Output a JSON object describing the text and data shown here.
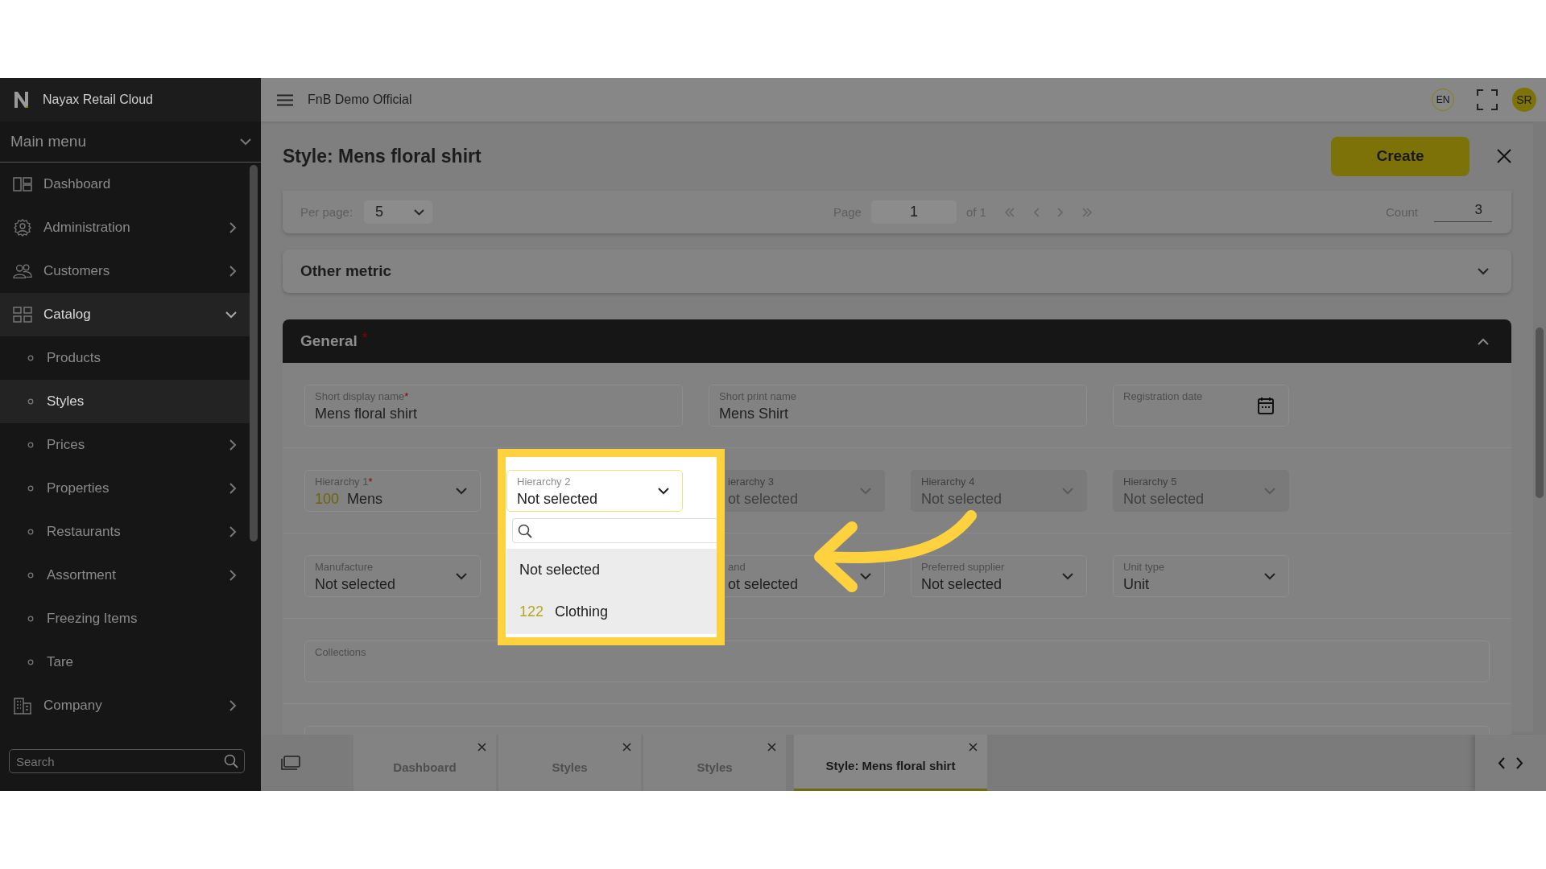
{
  "app": {
    "name": "Nayax Retail Cloud"
  },
  "sidebar": {
    "menu_title": "Main menu",
    "items": [
      {
        "label": "Dashboard",
        "has_submenu": false,
        "selected": false
      },
      {
        "label": "Administration",
        "has_submenu": true,
        "selected": false
      },
      {
        "label": "Customers",
        "has_submenu": true,
        "selected": false
      },
      {
        "label": "Catalog",
        "has_submenu": true,
        "selected": true,
        "expanded": true,
        "children": [
          {
            "label": "Products",
            "has_submenu": false,
            "selected": false
          },
          {
            "label": "Styles",
            "has_submenu": false,
            "selected": true
          },
          {
            "label": "Prices",
            "has_submenu": true,
            "selected": false
          },
          {
            "label": "Properties",
            "has_submenu": true,
            "selected": false
          },
          {
            "label": "Restaurants",
            "has_submenu": true,
            "selected": false
          },
          {
            "label": "Assortment",
            "has_submenu": true,
            "selected": false
          },
          {
            "label": "Freezing Items",
            "has_submenu": false,
            "selected": false
          },
          {
            "label": "Tare",
            "has_submenu": false,
            "selected": false
          }
        ]
      },
      {
        "label": "Company",
        "has_submenu": true,
        "selected": false
      }
    ],
    "search": {
      "placeholder": "Search"
    }
  },
  "topbar": {
    "org": "FnB Demo Official",
    "language": "EN",
    "avatar": "SR"
  },
  "page": {
    "title": "Style: Mens floral shirt",
    "create_button": "Create"
  },
  "pagination": {
    "per_page_label": "Per page:",
    "per_page": "5",
    "page_label": "Page",
    "page": "1",
    "of": "of 1",
    "count_label": "Count",
    "count": "3"
  },
  "other_metric": {
    "title": "Other metric",
    "expanded": false
  },
  "general": {
    "title": "General",
    "mark": "*",
    "expanded": true,
    "name_fields": [
      {
        "kind": "text",
        "label": "Short display name",
        "mark": "*",
        "value": "Mens floral shirt"
      },
      {
        "kind": "text",
        "label": "Short print name",
        "value": "Mens Shirt"
      },
      {
        "kind": "date",
        "label": "Registration date"
      }
    ],
    "rows": [
      [
        {
          "kind": "select",
          "label": "Hierarchy 1",
          "mark": "*",
          "code": "100",
          "value": "Mens"
        },
        {
          "kind": "select",
          "label": "Hierarchy 2",
          "value": "Not selected",
          "open": true,
          "options": [
            {
              "label": "Not selected"
            },
            {
              "code": "122",
              "label": "Clothing"
            }
          ]
        },
        {
          "kind": "select",
          "label": "ierarchy 3",
          "value": "ot selected",
          "disabled": true,
          "covered": true
        },
        {
          "kind": "select",
          "label": "Hierarchy 4",
          "value": "Not selected",
          "disabled": true
        },
        {
          "kind": "select",
          "label": "Hierarchy 5",
          "value": "Not selected",
          "disabled": true
        }
      ],
      [
        {
          "kind": "select",
          "label": "Manufacture",
          "value": "Not selected"
        },
        {
          "kind": "covered"
        },
        {
          "kind": "select",
          "label": "and",
          "value": "ot selected",
          "covered": true
        },
        {
          "kind": "select",
          "label": "Preferred supplier",
          "value": "Not selected"
        },
        {
          "kind": "select",
          "label": "Unit type",
          "value": "Unit"
        }
      ]
    ],
    "collections": {
      "label": "Collections"
    }
  },
  "tabs": [
    {
      "label": "Dashboard",
      "selected": false
    },
    {
      "label": "Styles",
      "selected": false
    },
    {
      "label": "Styles",
      "selected": false
    },
    {
      "label": "Style: Mens floral shirt",
      "selected": true
    }
  ]
}
